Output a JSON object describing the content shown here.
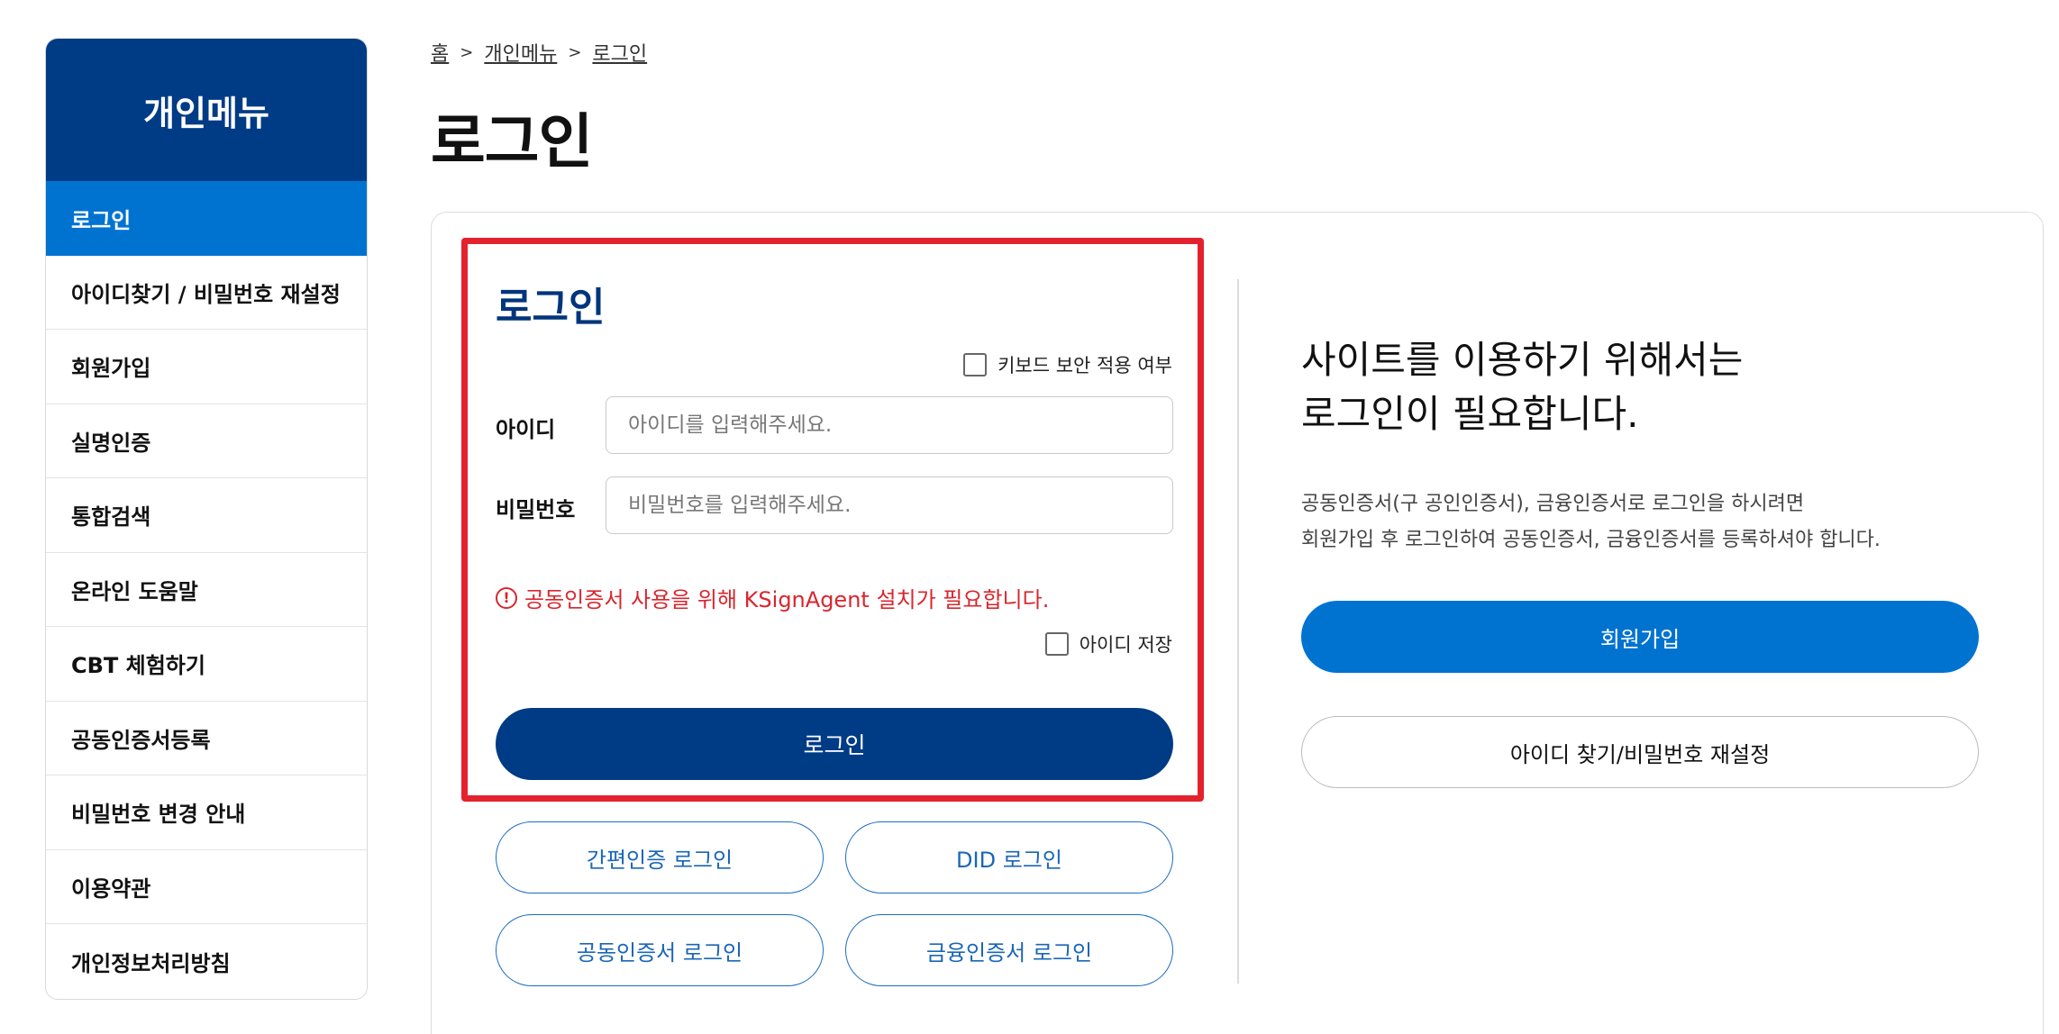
{
  "sidebar": {
    "title": "개인메뉴",
    "items": [
      {
        "label": "로그인",
        "active": true
      },
      {
        "label": "아이디찾기 / 비밀번호 재설정"
      },
      {
        "label": "회원가입"
      },
      {
        "label": "실명인증"
      },
      {
        "label": "통합검색"
      },
      {
        "label": "온라인 도움말"
      },
      {
        "label": "CBT 체험하기"
      },
      {
        "label": "공동인증서등록"
      },
      {
        "label": "비밀번호 변경 안내"
      },
      {
        "label": "이용약관"
      },
      {
        "label": "개인정보처리방침"
      }
    ]
  },
  "breadcrumb": {
    "items": [
      "홈",
      "개인메뉴",
      "로그인"
    ],
    "separator": ">"
  },
  "page_title": "로그인",
  "login_form": {
    "title": "로그인",
    "keyboard_security_label": "키보드 보안 적용 여부",
    "keyboard_security_checked": false,
    "id_label": "아이디",
    "id_placeholder": "아이디를 입력해주세요.",
    "id_value": "",
    "password_label": "비밀번호",
    "password_placeholder": "비밀번호를 입력해주세요.",
    "password_value": "",
    "warning_text": "공동인증서 사용을 위해 KSignAgent 설치가 필요합니다.",
    "warning_icon_glyph": "!",
    "save_id_label": "아이디 저장",
    "save_id_checked": false,
    "submit_label": "로그인"
  },
  "alt_login": {
    "simple_auth": "간편인증 로그인",
    "did": "DID 로그인",
    "joint_cert": "공동인증서 로그인",
    "financial_cert": "금융인증서 로그인"
  },
  "info_panel": {
    "title_line1": "사이트를 이용하기 위해서는",
    "title_line2": "로그인이 필요합니다.",
    "desc_line1": "공동인증서(구 공인인증서), 금융인증서로 로그인을 하시려면",
    "desc_line2": "회원가입 후 로그인하여 공동인증서, 금융인증서를 등록하셔야 합니다.",
    "signup_label": "회원가입",
    "find_label": "아이디 찾기/비밀번호 재설정"
  },
  "colors": {
    "primary_navy": "#003b86",
    "primary_blue": "#0073d1",
    "highlight_red": "#e3222d",
    "warning_red": "#d9262e"
  }
}
